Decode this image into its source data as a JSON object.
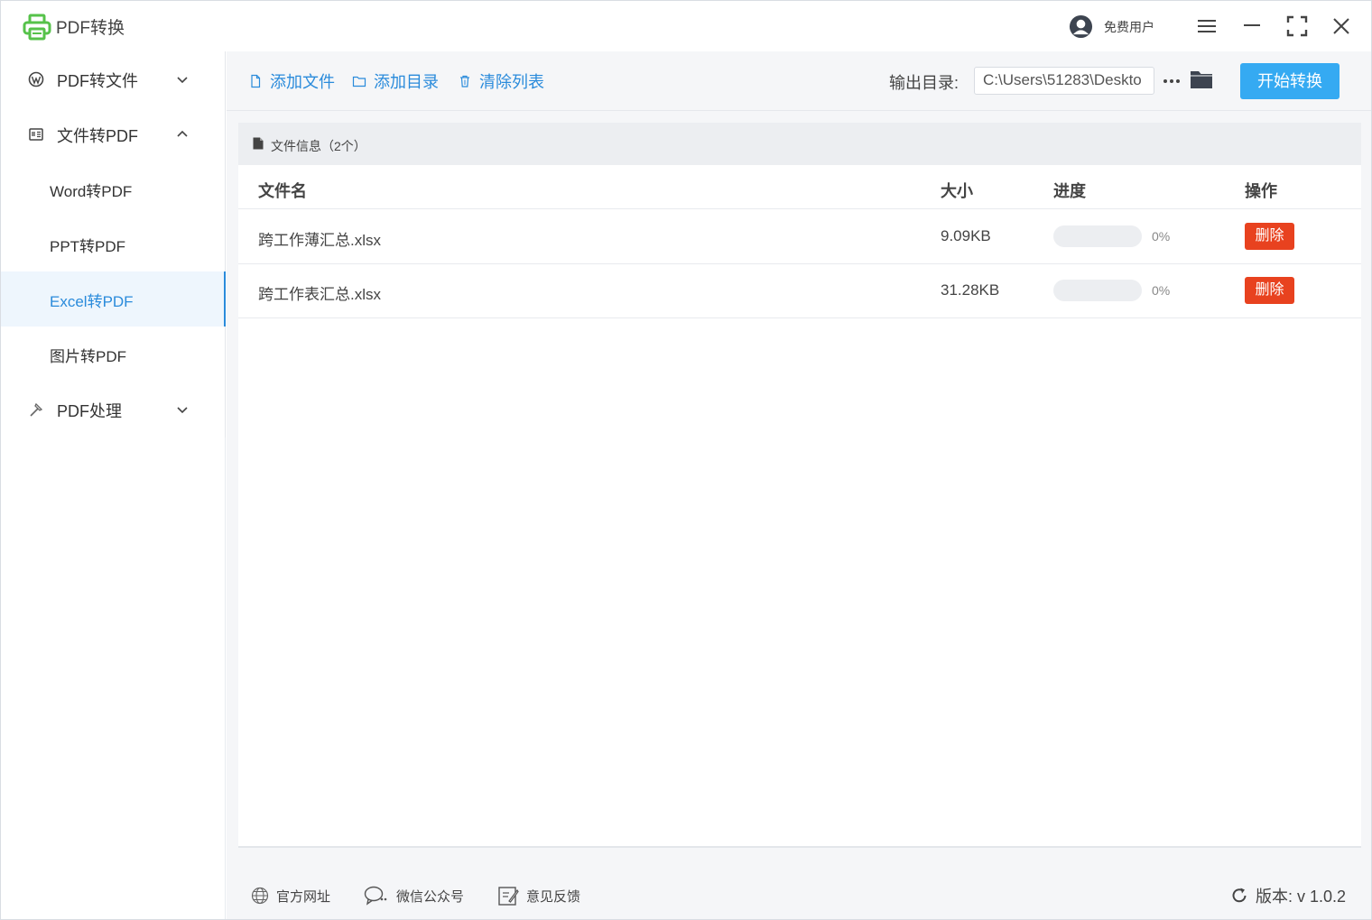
{
  "app": {
    "title": "PDF转换",
    "user_label": "免费用户"
  },
  "colors": {
    "accent": "#2a8bdb",
    "start_button": "#35aaf2",
    "delete_button": "#e8421f",
    "logo": "#56c24a"
  },
  "sidebar": {
    "groups": [
      {
        "label": "PDF转文件",
        "icon": "wordpress-icon",
        "expanded": false
      },
      {
        "label": "文件转PDF",
        "icon": "document-list-icon",
        "expanded": true
      },
      {
        "label": "PDF处理",
        "icon": "hammer-icon",
        "expanded": false
      }
    ],
    "sub_items": [
      {
        "label": "Word转PDF"
      },
      {
        "label": "PPT转PDF"
      },
      {
        "label": "Excel转PDF",
        "active": true
      },
      {
        "label": "图片转PDF"
      }
    ]
  },
  "toolbar": {
    "add_file": "添加文件",
    "add_dir": "添加目录",
    "clear_list": "清除列表",
    "output_label": "输出目录:",
    "output_path": "C:\\Users\\51283\\Deskto",
    "start_button": "开始转换"
  },
  "panel": {
    "title": "文件信息（2个）",
    "columns": {
      "name": "文件名",
      "size": "大小",
      "progress": "进度",
      "action": "操作"
    },
    "rows": [
      {
        "name": "跨工作薄汇总.xlsx",
        "size": "9.09KB",
        "progress": 0,
        "progress_text": "0%",
        "action": "删除"
      },
      {
        "name": "跨工作表汇总.xlsx",
        "size": "31.28KB",
        "progress": 0,
        "progress_text": "0%",
        "action": "删除"
      }
    ]
  },
  "footer": {
    "website": "官方网址",
    "wechat": "微信公众号",
    "feedback": "意见反馈",
    "version": "版本:  v 1.0.2"
  }
}
